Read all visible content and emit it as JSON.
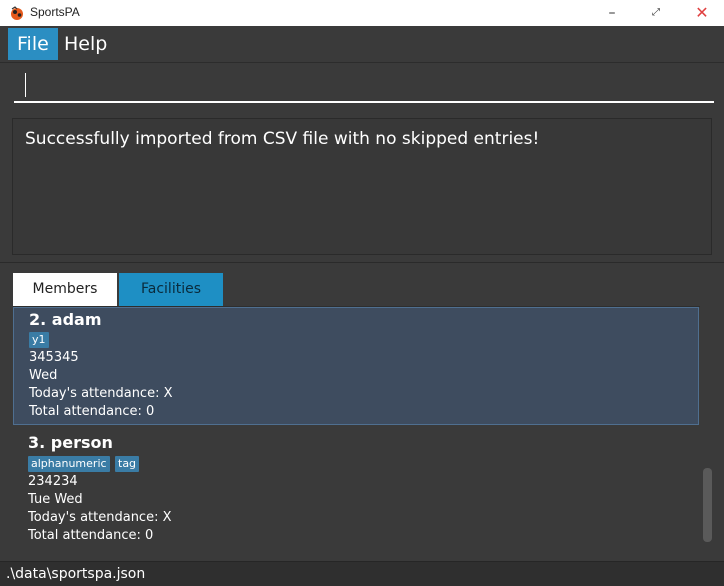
{
  "window": {
    "title": "SportsPA",
    "minimize_glyph": "–",
    "maximize_glyph": "⤢",
    "close_glyph": "✕"
  },
  "menu": {
    "file": "File",
    "help": "Help"
  },
  "command": {
    "value": "",
    "placeholder": ""
  },
  "result": {
    "message": "Successfully imported from CSV file with no skipped entries!"
  },
  "tabs": [
    {
      "label": "Members"
    },
    {
      "label": "Facilities"
    }
  ],
  "members": [
    {
      "name": "2.  adam",
      "tags": [
        "y1"
      ],
      "phone": "345345",
      "days": "Wed",
      "today": "Today's attendance: X",
      "total": "Total attendance: 0"
    },
    {
      "name": "3.  person",
      "tags": [
        "alphanumeric",
        "tag"
      ],
      "phone": "234234",
      "days": "Tue Wed",
      "today": "Today's attendance: X",
      "total": "Total attendance: 0"
    }
  ],
  "status": {
    "path": ".\\data\\sportspa.json"
  },
  "colors": {
    "accent": "#2b8ec2",
    "selected_card": "#3e4c5f",
    "tag": "#3a7ca5",
    "background": "#3a3a3a"
  },
  "icons": {
    "app": "app-logo-icon"
  }
}
